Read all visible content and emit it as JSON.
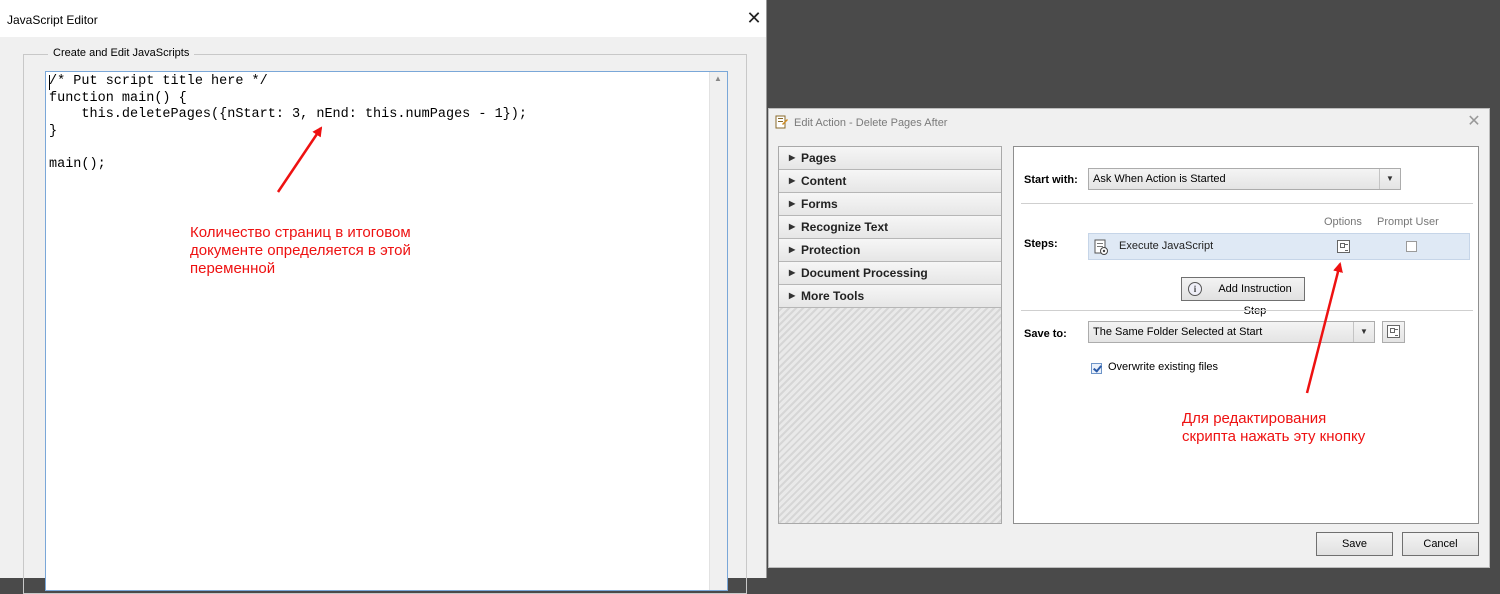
{
  "js_editor": {
    "title": "JavaScript Editor",
    "group_label": "Create and Edit JavaScripts",
    "code": "/* Put script title here */\nfunction main() {\n    this.deletePages({nStart: 3, nEnd: this.numPages - 1});\n}\n\nmain();",
    "annotation": "Количество страниц в итоговом\nдокументе определяется в этой\nпеременной"
  },
  "edit_action": {
    "title": "Edit Action - Delete Pages After",
    "tools": [
      {
        "label": "Pages"
      },
      {
        "label": "Content"
      },
      {
        "label": "Forms"
      },
      {
        "label": "Recognize Text"
      },
      {
        "label": "Protection"
      },
      {
        "label": "Document Processing"
      },
      {
        "label": "More Tools"
      }
    ],
    "start_with": {
      "label": "Start with:",
      "value": "Ask When Action is Started"
    },
    "steps": {
      "label": "Steps:",
      "options_header": "Options",
      "prompt_header": "Prompt User",
      "items": [
        {
          "label": "Execute JavaScript",
          "prompt_user": false
        }
      ]
    },
    "add_step_label": "Add Instruction Step",
    "save_to": {
      "label": "Save to:",
      "value": "The Same Folder Selected at Start"
    },
    "overwrite": {
      "label": "Overwrite existing files",
      "checked": true
    },
    "annotation": "Для редактирования\nскрипта нажать эту кнопку",
    "save_button": "Save",
    "cancel_button": "Cancel"
  },
  "colors": {
    "annotation": "#ee1111",
    "desktop": "#4a4a4a",
    "step_highlight": "#dfe9f5"
  },
  "icons": [
    "close-icon",
    "edit-action-icon",
    "chevron-right-icon",
    "javascript-step-icon",
    "options-icon",
    "info-icon",
    "checkbox-checked-icon",
    "dropdown-arrow-icon"
  ]
}
